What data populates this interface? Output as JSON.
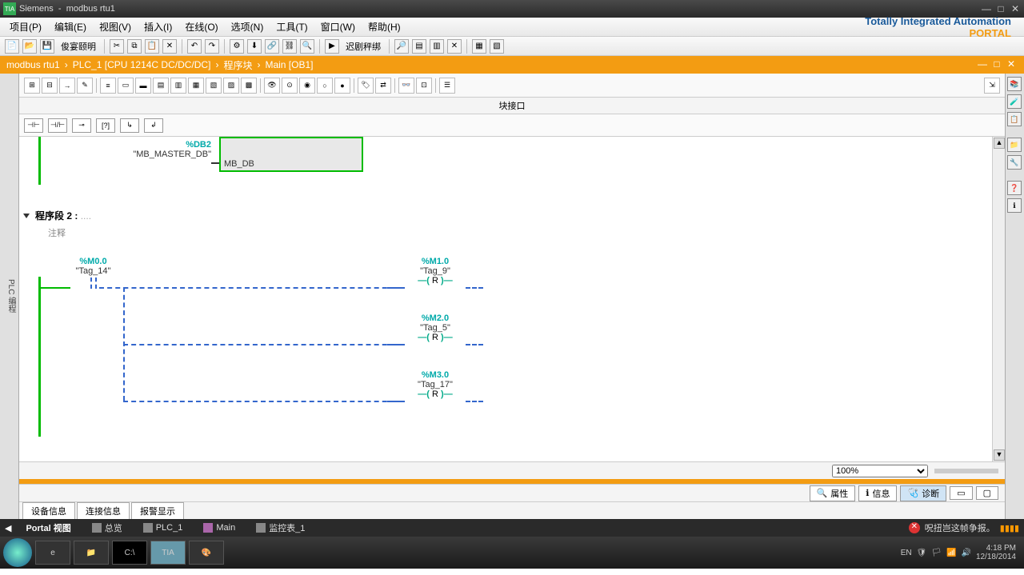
{
  "titlebar": {
    "app": "Siemens",
    "project": "modbus rtu1"
  },
  "menu": {
    "project": "项目(P)",
    "edit": "编辑(E)",
    "view": "视图(V)",
    "insert": "插入(I)",
    "online": "在线(O)",
    "options": "选项(N)",
    "tools": "工具(T)",
    "window": "窗口(W)",
    "help": "帮助(H)"
  },
  "toolbar_text": {
    "t1": "俊宴颐明",
    "t2": "迟剧秤绑"
  },
  "brand": {
    "line1": "Totally Integrated Automation",
    "line2": "PORTAL"
  },
  "breadcrumb": {
    "p1": "modbus rtu1",
    "p2": "PLC_1 [CPU 1214C DC/DC/DC]",
    "p3": "程序块",
    "p4": "Main [OB1]"
  },
  "interface_hdr": "块接口",
  "leftrail": "PLC 编程",
  "block1": {
    "db": "%DB2",
    "dbname": "\"MB_MASTER_DB\"",
    "pin": "MB_DB"
  },
  "network2": {
    "title": "程序段 2 :",
    "note": "注释"
  },
  "contact": {
    "addr": "%M0.0",
    "name": "\"Tag_14\""
  },
  "coils": [
    {
      "addr": "%M1.0",
      "name": "\"Tag_9\"",
      "op": "R"
    },
    {
      "addr": "%M2.0",
      "name": "\"Tag_5\"",
      "op": "R"
    },
    {
      "addr": "%M3.0",
      "name": "\"Tag_17\"",
      "op": "R"
    }
  ],
  "zoom": "100%",
  "props": {
    "p": "属性",
    "i": "信息",
    "d": "诊断"
  },
  "tabs": {
    "t1": "设备信息",
    "t2": "连接信息",
    "t3": "报警显示"
  },
  "portal": {
    "view": "Portal 视图",
    "ov": "总览",
    "plc": "PLC_1",
    "main": "Main",
    "watch": "监控表_1",
    "status": "呪扭岂这帧争报。"
  },
  "tray": {
    "lang": "EN",
    "time": "4:18 PM",
    "date": "12/18/2014"
  }
}
